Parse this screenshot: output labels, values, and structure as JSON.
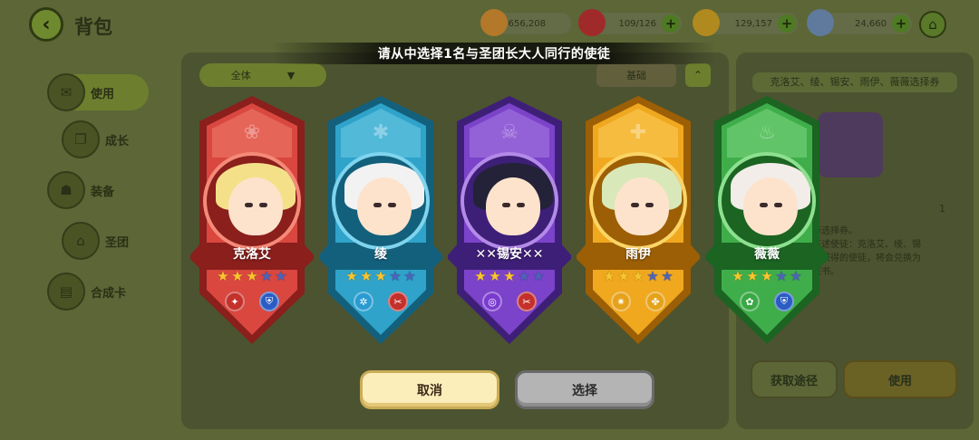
{
  "background": {
    "page_title": "背包",
    "resources": [
      {
        "name": "cookie-currency",
        "value": "656,208",
        "color": "#b3782a"
      },
      {
        "name": "stamina",
        "value": "109/126",
        "color": "#a02a2a"
      },
      {
        "name": "coin",
        "value": "129,157",
        "color": "#b08a1e"
      },
      {
        "name": "crystal",
        "value": "24,660",
        "color": "#5f7a9c"
      }
    ],
    "sidebar": [
      {
        "label": "使用",
        "icon": "bag-icon",
        "active": true
      },
      {
        "label": "成长",
        "icon": "book-icon",
        "active": false
      },
      {
        "label": "装备",
        "icon": "equipment-icon",
        "active": false
      },
      {
        "label": "圣团",
        "icon": "guild-icon",
        "active": false
      },
      {
        "label": "合成卡",
        "icon": "cards-icon",
        "active": false
      }
    ],
    "filter_label": "全体",
    "sort_label": "基础",
    "detail": {
      "title": "克洛艾、绫、锡安、雨伊、薇薇选择券",
      "count": "1",
      "description": "择选择券。\n下述使徒：克洛艾、绫、锡\n已获得的使徒，将会兑换为\n证书。",
      "source_label": "获取途径",
      "use_label": "使用"
    }
  },
  "modal": {
    "title": "请从中选择1名与圣团长大人同行的使徒",
    "cancel_label": "取消",
    "select_label": "选择",
    "cards": [
      {
        "name": "克洛艾",
        "theme": "#d9473f",
        "dark": "#8a1f1c",
        "light": "#f48a78",
        "hair": "#f5e08a",
        "top_icon": "❀",
        "stars_on": 3,
        "stars_total": 5,
        "badge_icons": [
          "✦",
          "⛨"
        ],
        "badge_colors": [
          "#c4302b",
          "#2b5cc4"
        ]
      },
      {
        "name": "绫",
        "theme": "#2fa3c9",
        "dark": "#13607c",
        "light": "#7fd4ee",
        "hair": "#f2f2f2",
        "top_icon": "✱",
        "stars_on": 3,
        "stars_total": 5,
        "badge_icons": [
          "✲",
          "✂"
        ],
        "badge_colors": [
          "#2a9bd1",
          "#c4302b"
        ]
      },
      {
        "name": "✕✕锡安✕✕",
        "theme": "#7b43c9",
        "dark": "#3e1f78",
        "light": "#b48ae8",
        "hair": "#232238",
        "top_icon": "☠",
        "stars_on": 3,
        "stars_total": 5,
        "badge_icons": [
          "◎",
          "✂"
        ],
        "badge_colors": [
          "#7a3bcf",
          "#c4302b"
        ]
      },
      {
        "name": "雨伊",
        "theme": "#f0a81f",
        "dark": "#9c5f05",
        "light": "#fbd466",
        "hair": "#d9e8b8",
        "top_icon": "✚",
        "stars_on": 3,
        "stars_total": 5,
        "badge_icons": [
          "✷",
          "✤"
        ],
        "badge_colors": [
          "#e5a21a",
          "#e5a21a"
        ]
      },
      {
        "name": "薇薇",
        "theme": "#3fae4a",
        "dark": "#1b6422",
        "light": "#8de08f",
        "hair": "#f2ede8",
        "top_icon": "♨",
        "stars_on": 3,
        "stars_total": 5,
        "badge_icons": [
          "✿",
          "⛨"
        ],
        "badge_colors": [
          "#3aa845",
          "#2b5cc4"
        ]
      }
    ]
  }
}
